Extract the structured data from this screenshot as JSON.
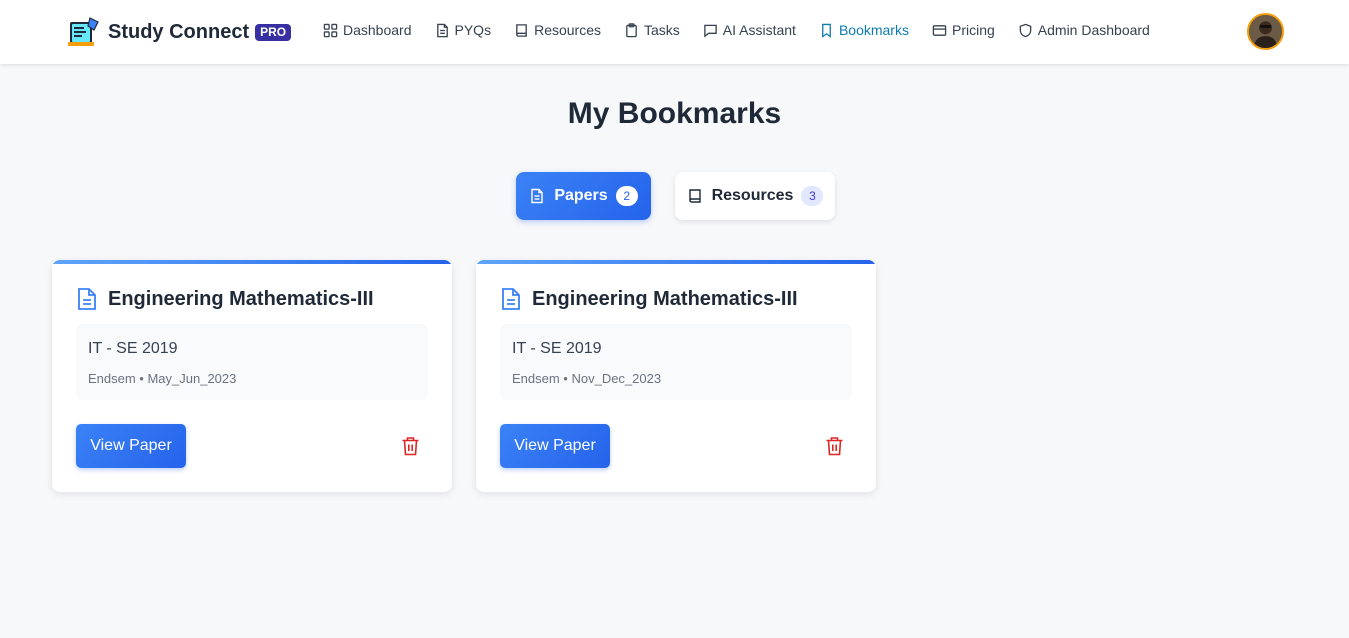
{
  "brand": {
    "name": "Study Connect",
    "badge": "PRO"
  },
  "nav": {
    "items": [
      {
        "label": "Dashboard",
        "icon": "grid-icon"
      },
      {
        "label": "PYQs",
        "icon": "file-text-icon"
      },
      {
        "label": "Resources",
        "icon": "book-icon"
      },
      {
        "label": "Tasks",
        "icon": "clipboard-icon"
      },
      {
        "label": "AI Assistant",
        "icon": "message-icon"
      },
      {
        "label": "Bookmarks",
        "icon": "bookmark-icon",
        "active": true
      },
      {
        "label": "Pricing",
        "icon": "credit-card-icon"
      },
      {
        "label": "Admin Dashboard",
        "icon": "shield-icon"
      }
    ]
  },
  "page": {
    "title": "My Bookmarks"
  },
  "tabs": {
    "papers": {
      "label": "Papers",
      "count": "2",
      "icon": "file-text-icon"
    },
    "resources": {
      "label": "Resources",
      "count": "3",
      "icon": "book-icon"
    }
  },
  "cards": [
    {
      "title": "Engineering Mathematics-III",
      "subtitle": "IT - SE 2019",
      "meta": "Endsem • May_Jun_2023",
      "button": "View Paper"
    },
    {
      "title": "Engineering Mathematics-III",
      "subtitle": "IT - SE 2019",
      "meta": "Endsem • Nov_Dec_2023",
      "button": "View Paper"
    }
  ],
  "colors": {
    "primary": "#2563eb",
    "active_nav": "#0e7ab0",
    "danger": "#dc2626",
    "badge": "#3730a3"
  }
}
